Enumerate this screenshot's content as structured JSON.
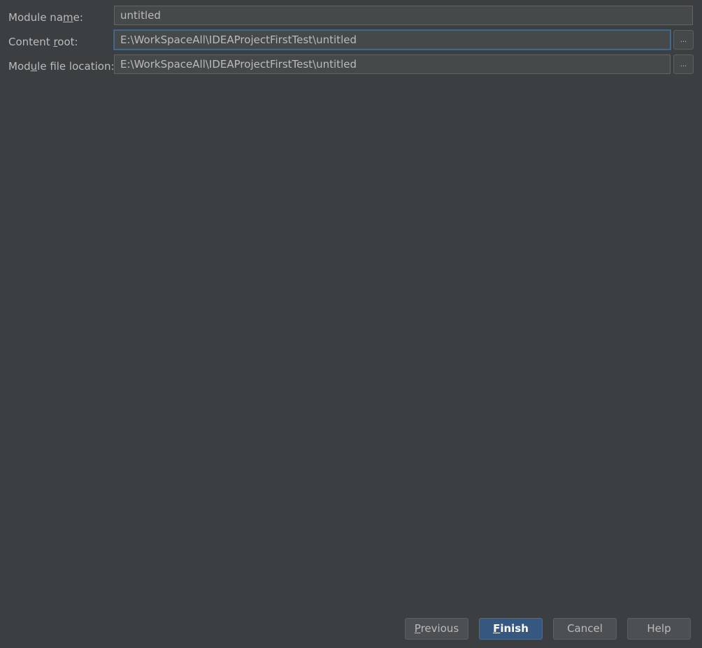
{
  "form": {
    "module_name": {
      "label_before": "Module na",
      "label_mnemonic": "m",
      "label_after": "e:",
      "value": "untitled"
    },
    "content_root": {
      "label_before": "Content ",
      "label_mnemonic": "r",
      "label_after": "oot:",
      "value": "E:\\WorkSpaceAll\\IDEAProjectFirstTest\\untitled",
      "browse_label": "..."
    },
    "module_file_location": {
      "label_before": "Mod",
      "label_mnemonic": "u",
      "label_after": "le file location:",
      "value": "E:\\WorkSpaceAll\\IDEAProjectFirstTest\\untitled",
      "browse_label": "..."
    }
  },
  "buttons": {
    "previous": {
      "mnemonic": "P",
      "rest": "revious"
    },
    "finish": {
      "mnemonic": "F",
      "rest": "inish"
    },
    "cancel": {
      "label": "Cancel"
    },
    "help": {
      "label": "Help"
    }
  },
  "colors": {
    "background": "#3c3f41",
    "input_background": "#45494a",
    "focus_border": "#466d94",
    "default_button": "#365880",
    "text": "#bbbbbb"
  }
}
